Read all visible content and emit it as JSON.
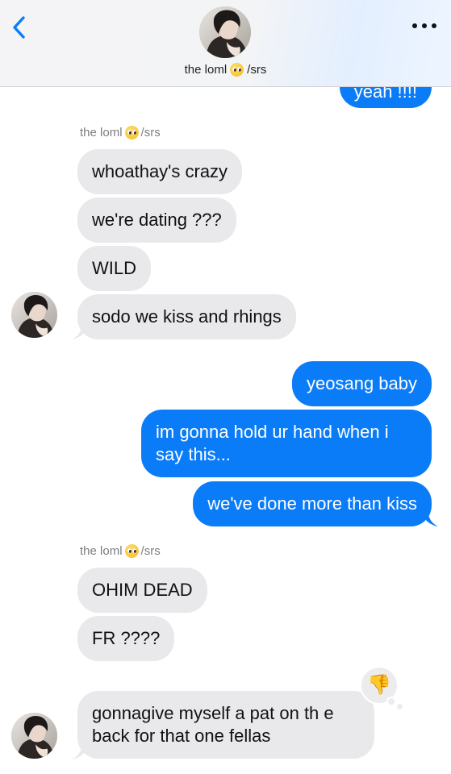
{
  "header": {
    "contact_name": "the loml",
    "contact_suffix": "/srs",
    "back_icon": "chevron-left-icon",
    "more_icon": "ellipsis-icon"
  },
  "colors": {
    "outgoing_bubble": "#0b7cf8",
    "incoming_bubble": "#e9e9eb",
    "accent": "#0b7cf8"
  },
  "thread": {
    "top_partial_outgoing": "yeah !!!!",
    "group1": {
      "sender": "the loml",
      "sender_suffix": "/srs",
      "messages": [
        "whoathay's crazy",
        "we're dating ???",
        "WILD",
        "sodo we kiss and rhings"
      ]
    },
    "group2": {
      "messages": [
        "yeosang baby",
        "im gonna hold ur hand when i say this...",
        "we've done more than kiss"
      ]
    },
    "group3": {
      "sender": "the loml",
      "sender_suffix": "/srs",
      "messages": [
        "OHIM DEAD",
        "FR ????",
        "gonnagive myself a pat on th e back for that one fellas"
      ],
      "reaction": "👎"
    }
  }
}
